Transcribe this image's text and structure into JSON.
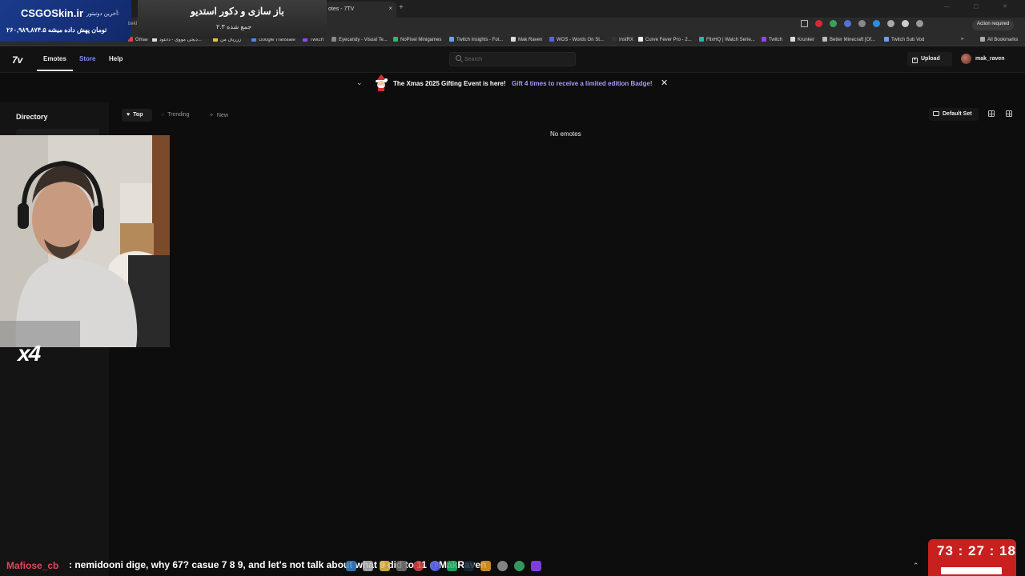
{
  "browser": {
    "tab_title": "otes - 7TV",
    "tab_close": "×",
    "new_tab": "+",
    "action_required": "Action required",
    "bookmarks": [
      "Gmail",
      "دیجی مووی - دانلود...",
      "ززریال من",
      "Google Translate",
      "Twitch",
      "Eyecandy - Visual Te...",
      "NoPixel Minigames",
      "Twitch Insights - Fol...",
      "Mak Raven",
      "WOS - Words On St...",
      "InstRX",
      "Curve Fever Pro - 2...",
      "FlixHQ | Watch Serie...",
      "Twitch",
      "Krunker",
      "Better Minecraft [Of...",
      "Twitch Sub Vod"
    ],
    "bookmarks_more": "»",
    "all_bookmarks": "All Bookmarks"
  },
  "overlay": {
    "donate_brand": "CSGOSkin.ir",
    "donate_label": "آخرین دونیتور:",
    "donate_amount": "۲۶۰,۹۸۹,۸۷۴.۵ تومان پهش داده میشه",
    "sponsor_title": "باز سازی و دکور استدیو",
    "sponsor_sub": "۲.۳ جمع شده",
    "sponsor_left": "bekI",
    "multiplier": "x4",
    "ticker_user": "Mafiose_cb",
    "ticker_message": ": nemidooni dige, why 67? casue 7 8 9, and let's not talk about what 9 did to 11 @MakRaven",
    "timer": "73 : 27 : 18"
  },
  "nav": {
    "logo": "7v",
    "emotes": "Emotes",
    "store": "Store",
    "help": "Help",
    "search_placeholder": "Search",
    "upload": "Upload",
    "username": "mak_raven"
  },
  "banner": {
    "text": "The Xmas 2025 Gifting Event is here!",
    "link": "Gift 4 times to receive a limited edition Badge!",
    "close": "✕",
    "chevron": "⌄"
  },
  "sidebar": {
    "directory": "Directory"
  },
  "filters": {
    "top": "Top",
    "trending": "Trending",
    "new": "New"
  },
  "toolbar": {
    "default_set": "Default Set"
  },
  "main": {
    "empty": "No emotes"
  },
  "colors": {
    "accent": "#a79cff",
    "store": "#7c8cff",
    "timer_bg": "#c7201f",
    "ticker_user": "#e0455a"
  }
}
